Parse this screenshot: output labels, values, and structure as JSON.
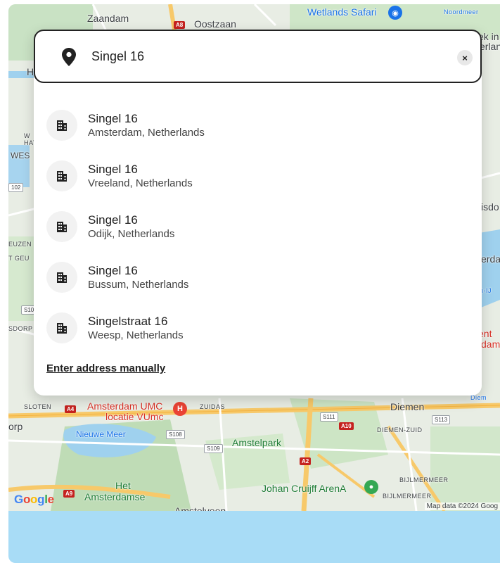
{
  "search": {
    "value": "Singel 16",
    "icon": "location-pin-icon",
    "clear_icon": "close-icon",
    "clear_label": "×"
  },
  "results": [
    {
      "title": "Singel 16",
      "subtitle": "Amsterdam, Netherlands",
      "icon": "building-icon"
    },
    {
      "title": "Singel 16",
      "subtitle": "Vreeland, Netherlands",
      "icon": "building-icon"
    },
    {
      "title": "Singel 16",
      "subtitle": "Odijk, Netherlands",
      "icon": "building-icon"
    },
    {
      "title": "Singel 16",
      "subtitle": "Bussum, Netherlands",
      "icon": "building-icon"
    },
    {
      "title": "Singelstraat 16",
      "subtitle": "Weesp, Netherlands",
      "icon": "building-icon"
    }
  ],
  "manual_entry": "Enter address manually",
  "map": {
    "labels": {
      "zaandam": "Zaandam",
      "oostzaan": "Oostzaan",
      "wetlands": "Wetlands Safari",
      "noordmeer": "Noordmeer",
      "amc": "Amsterdam UMC",
      "amc2": "locatie VUmc",
      "nieuwe_meer": "Nieuwe Meer",
      "amstelpark": "Amstelpark",
      "diemen": "Diemen",
      "diemen_zuid": "DIEMEN-ZUID",
      "bijlmermeer": "BIJLMERMEER",
      "arena": "Johan Cruijff ArenA",
      "zuidas": "ZUIDAS",
      "het": "Het",
      "amsterdamse": "Amsterdamse",
      "slotervaart": "SLOTEN",
      "amstelveen": "Amstelveen",
      "bijlmer2": "BIJLMERMEER",
      "diem": "Diem",
      "erdam": "erda",
      "rp": "orp",
      "ek": "ek in",
      "erlan": "erlan",
      "isdo": "isdo",
      "gdorp": "SDORP",
      "euzen": "EUZEN",
      "wes": "WES",
      "gel": "T GEU",
      "s10": "S10",
      "n102": "102",
      "hay": "HAY",
      "w": "W",
      "h": "H",
      "entdam": "ent",
      "dam": "dam",
      "n_ij": "n-IJ"
    },
    "shields": {
      "a8": "A8",
      "a4": "A4",
      "a10": "A10",
      "a2": "A2",
      "a9": "A9",
      "s108": "S108",
      "s109": "S109",
      "s111": "S111",
      "s113": "S113"
    },
    "google": "Google",
    "attribution": "Map data ©2024 Goog"
  }
}
